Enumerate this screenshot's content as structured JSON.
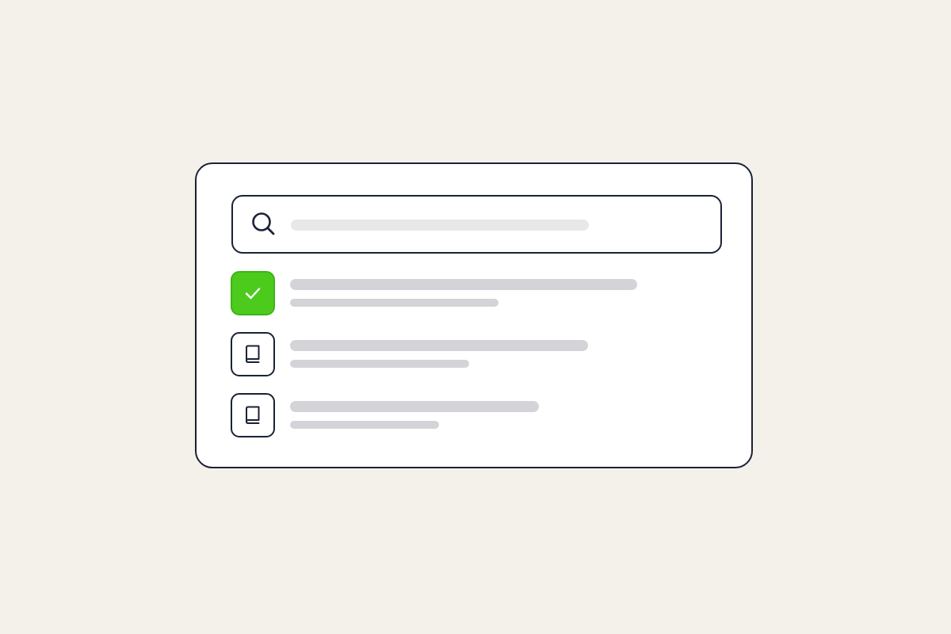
{
  "search": {
    "icon": "search-icon"
  },
  "results": [
    {
      "state": "selected",
      "icon": "checkmark-icon",
      "accent": "#4ccb1d"
    },
    {
      "state": "unselected",
      "icon": "book-icon"
    },
    {
      "state": "unselected",
      "icon": "book-icon"
    }
  ],
  "colors": {
    "background": "#f4f1ea",
    "outline": "#1b2236",
    "accent": "#4ccb1d",
    "placeholder": "#d4d4d8"
  }
}
